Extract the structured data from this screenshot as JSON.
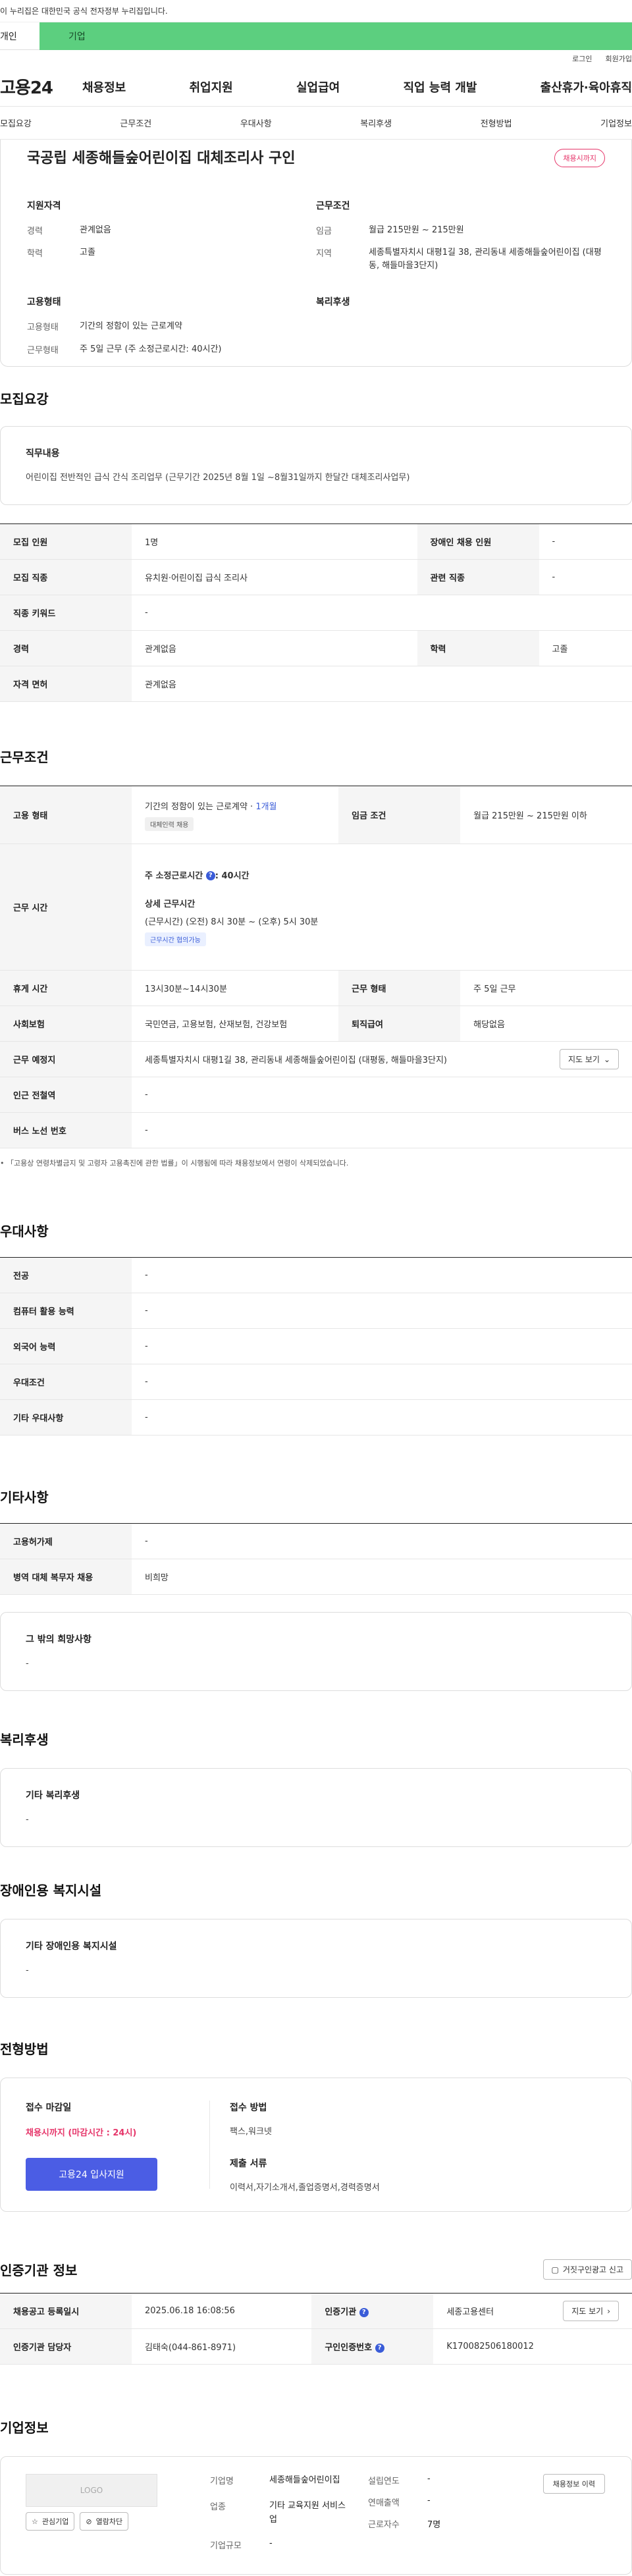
{
  "gov_banner": "이 누리집은 대한민국 공식 전자정부 누리집입니다.",
  "type_tabs": {
    "personal": "개인",
    "company": "기업"
  },
  "util_links": [
    "로그인",
    "회원가입"
  ],
  "gnb": {
    "logo": "고용24",
    "items": [
      "채용정보",
      "취업지원",
      "실업급여",
      "직업 능력 개발",
      "출산휴가·육아휴직"
    ]
  },
  "anchor_nav": [
    "모집요강",
    "근무조건",
    "우대사항",
    "복리후생",
    "전형방법",
    "기업정보"
  ],
  "summary": {
    "title": "국공립 세종해들숲어린이집 대체조리사 구인",
    "badge": "채용시까지",
    "qual": {
      "heading": "지원자격",
      "rows": [
        {
          "k": "경력",
          "v": "관계없음"
        },
        {
          "k": "학력",
          "v": "고졸"
        }
      ]
    },
    "work": {
      "heading": "근무조건",
      "rows": [
        {
          "k": "임금",
          "v": "월급 215만원 ~ 215만원"
        },
        {
          "k": "지역",
          "v": "세종특별자치시 대평1길 38, 관리동내 세종해들숲어린이집 (대평동, 해들마을3단지)"
        }
      ]
    },
    "emp": {
      "heading": "고용형태",
      "rows": [
        {
          "k": "고용형태",
          "v": "기간의 정함이 있는 근로계약"
        },
        {
          "k": "근무형태",
          "v": "주 5일 근무 (주 소정근로시간: 40시간)"
        }
      ]
    },
    "welfare": {
      "heading": "복리후생"
    }
  },
  "recruit": {
    "heading": "모집요강",
    "job_box": {
      "title": "직무내용",
      "text": "어린이집 전반적인 급식 간식 조리업무 (근무기간 2025년 8월 1일 ~8월31일까지 한달간 대체조리사업무)"
    },
    "rows": {
      "count_k": "모집 인원",
      "count_v": "1명",
      "disabled_k": "장애인 채용 인원",
      "disabled_v": "-",
      "job_k": "모집 직종",
      "job_v": "유치원·어린이집 급식 조리사",
      "related_k": "관련 직종",
      "related_v": "-",
      "keyword_k": "직종 키워드",
      "keyword_v": "-",
      "career_k": "경력",
      "career_v": "관계없음",
      "edu_k": "학력",
      "edu_v": "고졸",
      "license_k": "자격 면허",
      "license_v": "관계없음"
    }
  },
  "work": {
    "heading": "근무조건",
    "emp_k": "고용 형태",
    "emp_v": "기간의 정함이 있는 근로계약 · ",
    "emp_period": "1개월",
    "emp_tag": "대체인력 채용",
    "wage_k": "임금 조건",
    "wage_v": "월급 215만원 ~ 215만원 이하",
    "time_k": "근무 시간",
    "time_weekly": "주 소정근로시간 ",
    "time_weekly_v": ": 40시간",
    "time_detail_h": "상세 근무시간",
    "time_detail_v": "(근무시간) (오전) 8시 30분 ~ (오후) 5시 30분",
    "time_tag": "근무시간 협의가능",
    "rest_k": "휴게 시간",
    "rest_v": "13시30분~14시30분",
    "form_k": "근무 형태",
    "form_v": "주 5일 근무",
    "ins_k": "사회보험",
    "ins_v": "국민연금, 고용보험, 산재보험, 건강보험",
    "sev_k": "퇴직급여",
    "sev_v": "해당없음",
    "loc_k": "근무 예정지",
    "loc_v": "세종특별자치시 대평1길 38, 관리동내 세종해들숲어린이집 (대평동, 해들마을3단지)",
    "map_btn": "지도 보기",
    "subway_k": "인근 전철역",
    "subway_v": "-",
    "bus_k": "버스 노선 번호",
    "bus_v": "-",
    "note": "「고용상 연령차별금지 및 고령자 고용촉진에 관한 법률」이 시행됨에 따라 채용정보에서 연령이 삭제되었습니다."
  },
  "pref": {
    "heading": "우대사항",
    "rows": [
      {
        "k": "전공",
        "v": "-"
      },
      {
        "k": "컴퓨터 활용 능력",
        "v": "-"
      },
      {
        "k": "외국어 능력",
        "v": "-"
      },
      {
        "k": "우대조건",
        "v": "-"
      },
      {
        "k": "기타 우대사항",
        "v": "-"
      }
    ]
  },
  "etc": {
    "heading": "기타사항",
    "rows": [
      {
        "k": "고용허가제",
        "v": "-"
      },
      {
        "k": "병역 대체 복무자 채용",
        "v": "비희망"
      }
    ],
    "box_title": "그 밖의 희망사항",
    "box_text": "-"
  },
  "welfare": {
    "heading": "복리후생",
    "box_title": "기타 복리후생",
    "box_text": "-"
  },
  "disability": {
    "heading": "장애인용 복지시설",
    "box_title": "기타 장애인용 복지시설",
    "box_text": "-"
  },
  "selection": {
    "heading": "전형방법",
    "deadline_h": "접수 마감일",
    "deadline_v": "채용시까지 (마감시간 : 24시)",
    "apply_btn": "고용24 입사지원",
    "method_h": "접수 방법",
    "method_v": "팩스,워크넷",
    "docs_h": "제출 서류",
    "docs_v": "이력서,자기소개서,졸업증명서,경력증명서"
  },
  "cert": {
    "heading": "인증기관 정보",
    "report_btn": "거짓구인광고 신고",
    "reg_k": "채용공고 등록일시",
    "reg_v": "2025.06.18 16:08:56",
    "org_k": "인증기관",
    "org_v": "세종고용센터",
    "map_btn": "지도 보기",
    "mgr_k": "인증기관 담당자",
    "mgr_v": "김태숙(044-861-8971)",
    "no_k": "구인인증번호",
    "no_v": "K170082506180012"
  },
  "company": {
    "heading": "기업정보",
    "logo": "LOGO",
    "fav_btn": "관심기업",
    "block_btn": "열람차단",
    "name_k": "기업명",
    "name_v": "세종해들숲어린이집",
    "industry_k": "업종",
    "industry_v": "기타 교육지원 서비스업",
    "scale_k": "기업규모",
    "scale_v": "-",
    "founded_k": "설립연도",
    "founded_v": "-",
    "sales_k": "연매출액",
    "sales_v": "-",
    "emp_k": "근로자수",
    "emp_v": "7명",
    "history_btn": "채용정보 이력"
  }
}
